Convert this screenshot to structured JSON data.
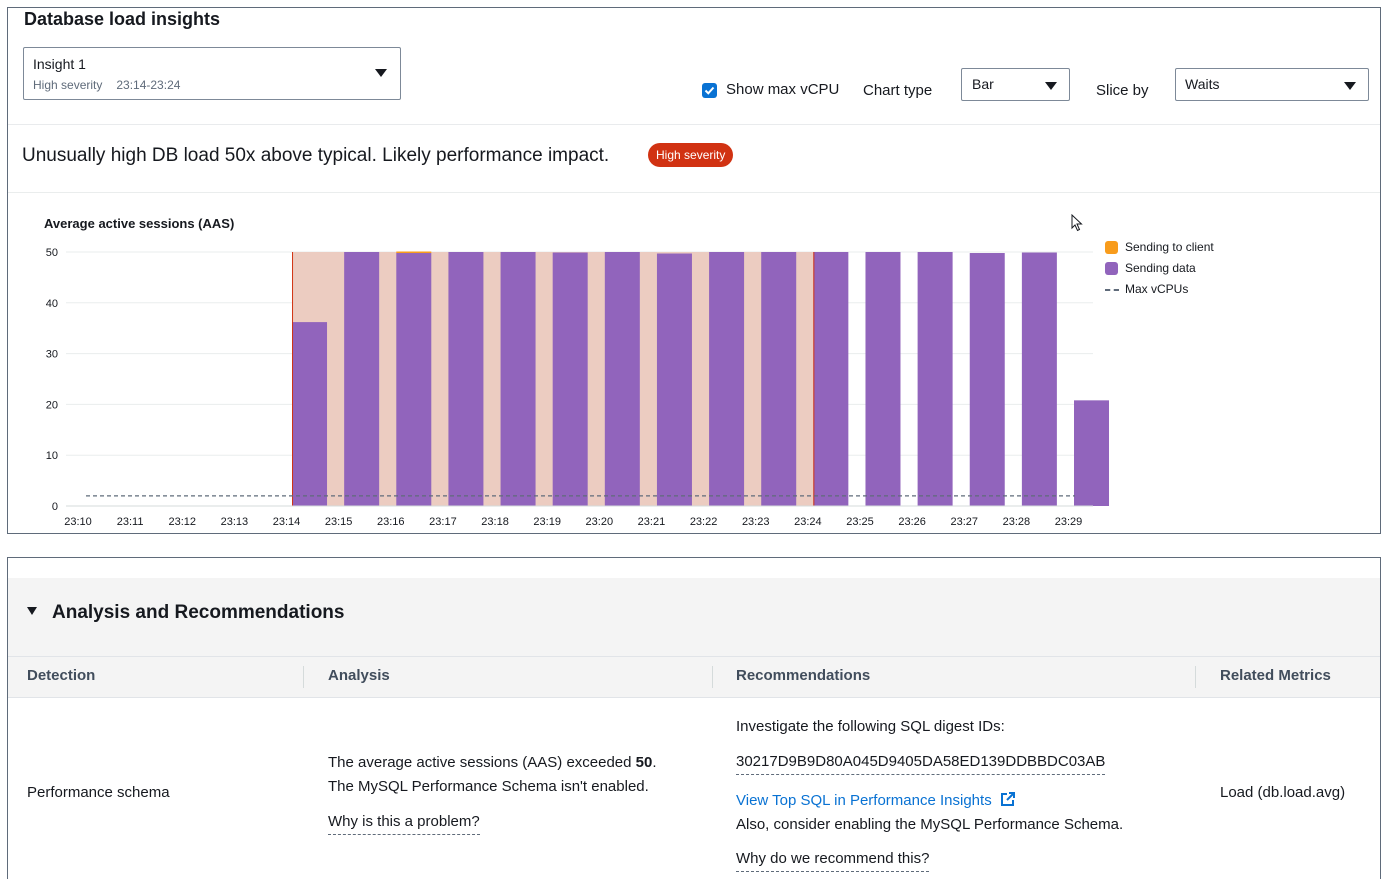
{
  "panel_title": "Database load insights",
  "insight_select": {
    "name": "Insight 1",
    "severity": "High severity",
    "time_range": "23:14-23:24"
  },
  "controls": {
    "show_max_vcpu_label": "Show max vCPU",
    "show_max_vcpu_checked": true,
    "chart_type_label": "Chart type",
    "chart_type_value": "Bar",
    "slice_by_label": "Slice by",
    "slice_by_value": "Waits"
  },
  "message": "Unusually high DB load 50x above typical. Likely performance impact.",
  "severity_badge": "High severity",
  "colors": {
    "sending_data": "#9164bc",
    "sending_to_client": "#f89c1c",
    "highlight_band": "#ecccc1",
    "severity_red": "#d13212",
    "link_blue": "#0972d3"
  },
  "chart_data": {
    "type": "bar",
    "title": "Average active sessions (AAS)",
    "categories": [
      "23:10",
      "23:11",
      "23:12",
      "23:13",
      "23:14",
      "23:15",
      "23:16",
      "23:17",
      "23:18",
      "23:19",
      "23:20",
      "23:21",
      "23:22",
      "23:23",
      "23:24",
      "23:25",
      "23:26",
      "23:27",
      "23:28",
      "23:29"
    ],
    "series": [
      {
        "name": "Sending to client",
        "values": [
          0,
          0,
          0,
          0,
          0,
          0,
          0.3,
          0,
          0,
          0,
          0,
          0,
          0,
          0,
          0,
          0,
          0,
          0,
          0,
          0
        ]
      },
      {
        "name": "Sending data",
        "values": [
          0,
          0,
          0,
          0,
          36.2,
          50,
          49.8,
          50,
          50,
          49.9,
          50,
          49.7,
          50,
          50,
          50,
          50,
          50,
          49.8,
          49.9,
          20.8
        ]
      }
    ],
    "max_vcpus": {
      "name": "Max vCPUs",
      "value": 2
    },
    "highlight_range": [
      "23:14",
      "23:24"
    ],
    "yticks": [
      0,
      10,
      20,
      30,
      40,
      50
    ],
    "ylim": [
      0,
      50
    ],
    "grid": true,
    "legend_position": "right"
  },
  "analysis": {
    "section_title": "Analysis and Recommendations",
    "headers": {
      "detection": "Detection",
      "analysis": "Analysis",
      "recommendations": "Recommendations",
      "related_metrics": "Related Metrics"
    },
    "row": {
      "detection": "Performance schema",
      "analysis_line1_pre": "The average active sessions (AAS) exceeded ",
      "analysis_value": "50",
      "analysis_line1_post": ".",
      "analysis_line2": "The MySQL Performance Schema isn't enabled.",
      "analysis_why": "Why is this a problem?",
      "rec_intro": "Investigate the following SQL digest IDs:",
      "rec_digest": "30217D9B9D80A045D9405DA58ED139DDBBDC03AB",
      "rec_link": "View Top SQL in Performance Insights",
      "rec_also": "Also, consider enabling the MySQL Performance Schema.",
      "rec_why": "Why do we recommend this?",
      "related_metric": "Load (db.load.avg)"
    }
  }
}
